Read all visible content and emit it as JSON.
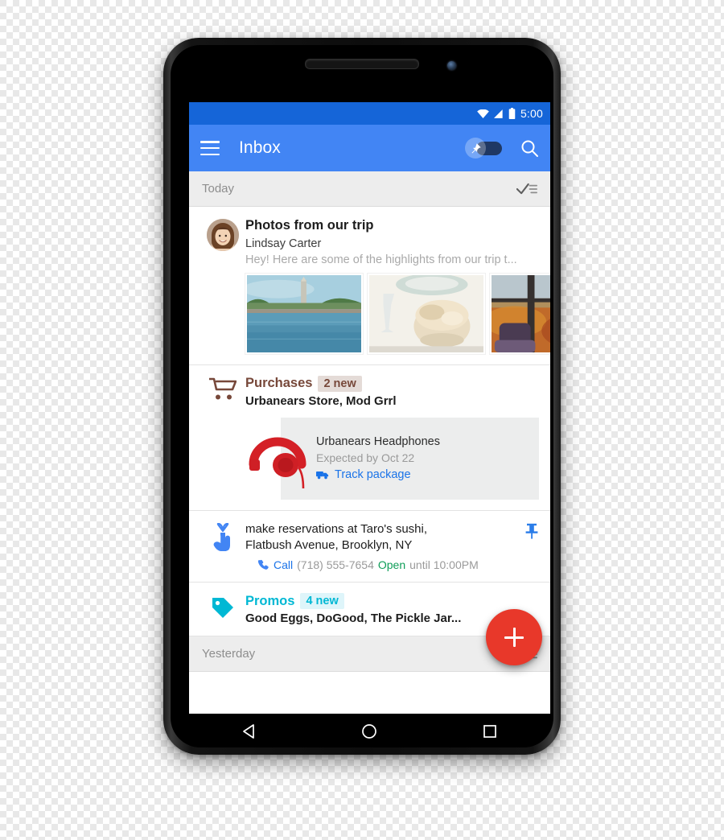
{
  "device": {
    "name": "android-phone-nexus",
    "speaker_top": "earpiece-speaker",
    "speaker_bottom": "bottom-speaker"
  },
  "status_bar": {
    "time": "5:00",
    "icons": [
      "wifi-icon",
      "cell-signal-icon",
      "battery-icon"
    ],
    "bg_color": "#1565d8"
  },
  "app_bar": {
    "title": "Inbox",
    "menu_icon": "hamburger-menu-icon",
    "search_icon": "search-icon",
    "pin_toggle": {
      "icon": "pin-icon",
      "state": "on"
    },
    "bg_color": "#4285f4"
  },
  "sections": [
    {
      "label": "Today",
      "sweep_icon": "sweep-done-icon"
    },
    {
      "label": "Yesterday",
      "sweep_icon": "sweep-done-icon"
    }
  ],
  "messages": {
    "photos": {
      "avatar": "contact-avatar-lindsay",
      "subject": "Photos from our trip",
      "sender": "Lindsay Carter",
      "snippet": "Hey! Here are some of the highlights from our trip t...",
      "thumbnails": [
        {
          "name": "thumbnail-washington-monument-reflecting-pool"
        },
        {
          "name": "thumbnail-dessert-on-table"
        },
        {
          "name": "thumbnail-autumn-view-through-window"
        }
      ]
    },
    "purchases": {
      "icon": "shopping-cart-icon",
      "bundle_name": "Purchases",
      "badge": "2 new",
      "senders": "Urbanears Store, Mod Grrl",
      "accent_color": "#77483a",
      "badge_bg": "#e4dbd7",
      "card": {
        "product_image": "red-headphones-image",
        "title": "Urbanears Headphones",
        "eta": "Expected by Oct 22",
        "link_icon": "truck-icon",
        "link_label": "Track package",
        "link_color": "#1a73e8"
      }
    },
    "reminder": {
      "icon": "finger-string-reminder-icon",
      "line1": "make reservations at Taro's sushi,",
      "line2": "Flatbush Avenue, Brooklyn, NY",
      "call_icon": "phone-icon",
      "call_label": "Call",
      "phone_number": "(718) 555-7654",
      "open_label": "Open",
      "hours": "until 10:00PM",
      "pin_icon": "pushpin-icon",
      "open_color": "#0f9d58"
    },
    "promos": {
      "icon": "price-tag-icon",
      "bundle_name": "Promos",
      "badge": "4 new",
      "senders": "Good Eggs, DoGood, The Pickle Jar...",
      "accent_color": "#00b8d4",
      "badge_bg": "#def5fa"
    }
  },
  "fab": {
    "icon": "plus-icon",
    "label": "Compose",
    "color": "#e8382a"
  },
  "nav_bar": {
    "back": "back-triangle-icon",
    "home": "home-circle-icon",
    "recents": "recents-square-icon"
  }
}
